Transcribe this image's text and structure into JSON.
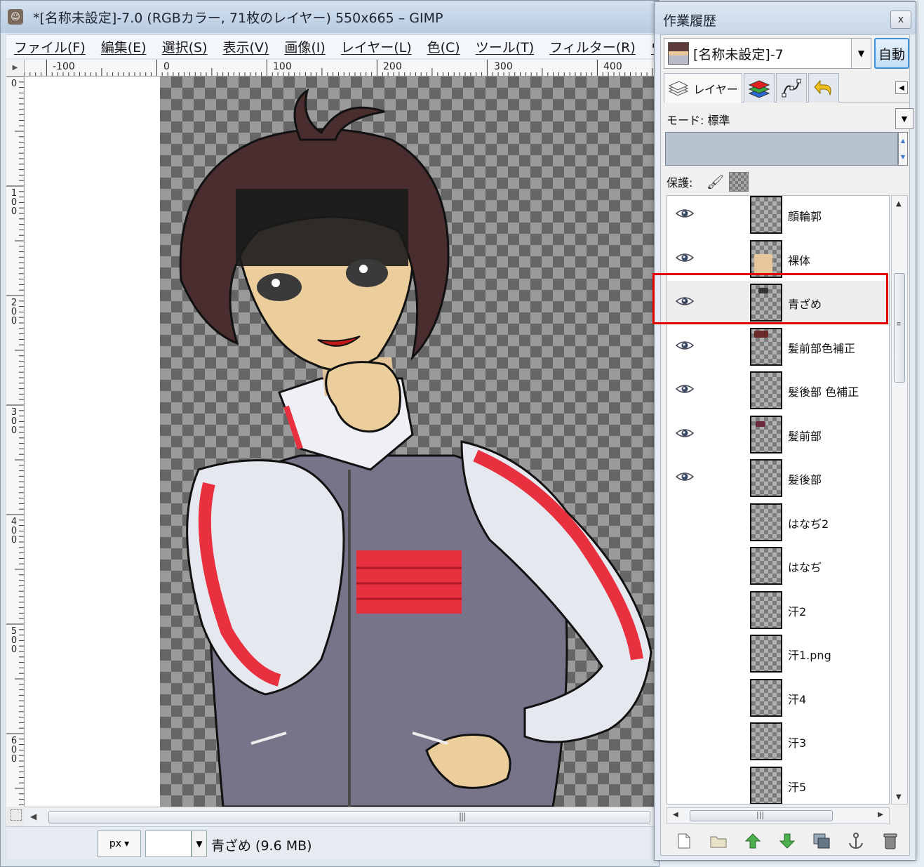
{
  "main_window": {
    "title": "*[名称未設定]-7.0 (RGBカラー, 71枚のレイヤー) 550x665 – GIMP",
    "menu": [
      "ファイル(F)",
      "編集(E)",
      "選択(S)",
      "表示(V)",
      "画像(I)",
      "レイヤー(L)",
      "色(C)",
      "ツール(T)",
      "フィルター(R)",
      "ウ"
    ],
    "h_ruler_labels": [
      "-100",
      "0",
      "100",
      "200",
      "300",
      "400"
    ],
    "v_ruler_labels": [
      "0",
      "100",
      "200",
      "300",
      "400",
      "500",
      "600"
    ],
    "status": {
      "unit": "px",
      "zoom_value": "",
      "text": "青ざめ (9.6 MB)"
    }
  },
  "dock": {
    "title": "作業履歴",
    "close_glyph": "x",
    "image_selector": "[名称未設定]-7",
    "auto_button": "自動",
    "tabs": {
      "layers": "レイヤー"
    },
    "mode_label": "モード: 標準",
    "lock_label": "保護:",
    "layers": [
      {
        "name": "顔輪郭",
        "visible": true
      },
      {
        "name": "裸体",
        "visible": true
      },
      {
        "name": "青ざめ",
        "visible": true,
        "selected": true
      },
      {
        "name": "髪前部色補正",
        "visible": true
      },
      {
        "name": "髪後部 色補正",
        "visible": true
      },
      {
        "name": "髪前部",
        "visible": true
      },
      {
        "name": "髪後部",
        "visible": true
      },
      {
        "name": "はなぢ2",
        "visible": false
      },
      {
        "name": "はなぢ",
        "visible": false
      },
      {
        "name": "汗2",
        "visible": false
      },
      {
        "name": "汗1.png",
        "visible": false
      },
      {
        "name": "汗4",
        "visible": false
      },
      {
        "name": "汗3",
        "visible": false
      },
      {
        "name": "汗5",
        "visible": false
      }
    ],
    "bottom_buttons": [
      "new-layer",
      "new-layer-group",
      "raise-layer",
      "lower-layer",
      "duplicate-layer",
      "anchor-layer",
      "delete-layer"
    ]
  },
  "colors": {
    "highlight": "#e00000",
    "accent": "#3a90d9"
  }
}
